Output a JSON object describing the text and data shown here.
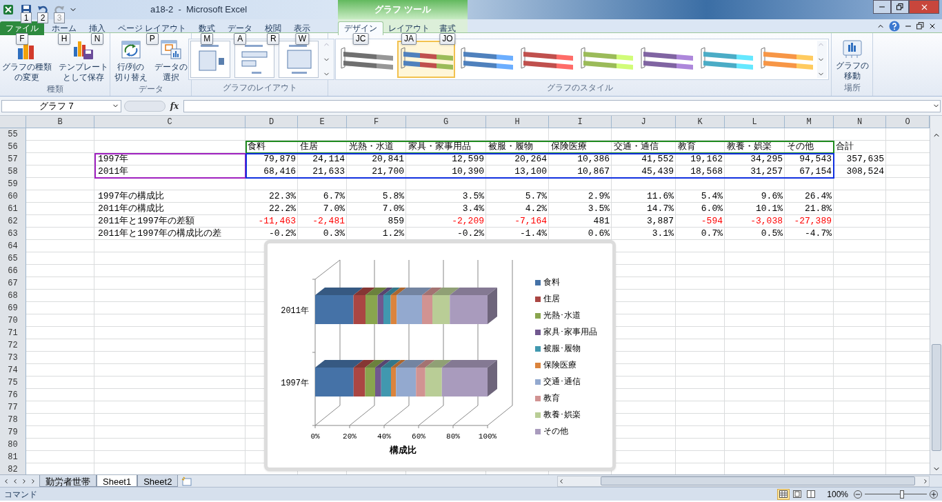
{
  "window": {
    "title": "a18-2  -  Microsoft Excel",
    "context_title": "グラフ ツール"
  },
  "quick_access": [
    {
      "keytip": "1",
      "disabled": false
    },
    {
      "keytip": "2",
      "disabled": false
    },
    {
      "keytip": "3",
      "disabled": true
    }
  ],
  "tabs": [
    {
      "label": "ファイル",
      "keytip": "F",
      "selected": false,
      "kind": "file"
    },
    {
      "label": "ホーム",
      "keytip": "H",
      "selected": false,
      "kind": "normal"
    },
    {
      "label": "挿入",
      "keytip": "N",
      "selected": false,
      "kind": "normal"
    },
    {
      "label": "ページ レイアウト",
      "keytip": "P",
      "selected": false,
      "kind": "normal"
    },
    {
      "label": "数式",
      "keytip": "M",
      "selected": false,
      "kind": "normal"
    },
    {
      "label": "データ",
      "keytip": "A",
      "selected": false,
      "kind": "normal"
    },
    {
      "label": "校閲",
      "keytip": "R",
      "selected": false,
      "kind": "normal"
    },
    {
      "label": "表示",
      "keytip": "W",
      "selected": false,
      "kind": "normal"
    },
    {
      "label": "デザイン",
      "keytip": "JC",
      "selected": true,
      "kind": "context"
    },
    {
      "label": "レイアウト",
      "keytip": "JA",
      "selected": false,
      "kind": "context"
    },
    {
      "label": "書式",
      "keytip": "JO",
      "selected": false,
      "kind": "context"
    }
  ],
  "ribbon": {
    "groups": [
      {
        "label": "種類",
        "kind": "buttons",
        "buttons": [
          {
            "lines": [
              "グラフの種類",
              "の変更"
            ]
          },
          {
            "lines": [
              "テンプレート",
              "として保存"
            ]
          }
        ]
      },
      {
        "label": "データ",
        "kind": "buttons",
        "buttons": [
          {
            "lines": [
              "行/列の",
              "切り替え"
            ]
          },
          {
            "lines": [
              "データの",
              "選択"
            ]
          }
        ]
      },
      {
        "label": "グラフのレイアウト",
        "kind": "layouts",
        "items": [
          {
            "selected": false
          },
          {
            "selected": false
          },
          {
            "selected": false
          }
        ]
      },
      {
        "label": "グラフのスタイル",
        "kind": "styles",
        "items": [
          {
            "kind": "mono",
            "color": "#707070",
            "selected": false
          },
          {
            "kind": "multi",
            "color": "#4f81bd",
            "selected": true
          },
          {
            "kind": "mono",
            "color": "#4f81bd",
            "selected": false
          },
          {
            "kind": "mono",
            "color": "#c0504d",
            "selected": false
          },
          {
            "kind": "mono",
            "color": "#9bbb59",
            "selected": false
          },
          {
            "kind": "mono",
            "color": "#8064a2",
            "selected": false
          },
          {
            "kind": "mono",
            "color": "#4bacc6",
            "selected": false
          },
          {
            "kind": "mono",
            "color": "#f79646",
            "selected": false
          }
        ]
      },
      {
        "label": "場所",
        "kind": "buttons",
        "buttons": [
          {
            "lines": [
              "グラフの",
              "移動"
            ]
          }
        ]
      }
    ]
  },
  "formula_bar": {
    "name_box": "グラフ 7",
    "function_label": "fx"
  },
  "grid": {
    "columns": [
      "B",
      "C",
      "D",
      "E",
      "F",
      "G",
      "H",
      "I",
      "J",
      "K",
      "L",
      "M",
      "N",
      "O"
    ],
    "rows": [
      {
        "number": "55",
        "kind": "values"
      },
      {
        "number": "56",
        "kind": "header",
        "cells": [
          {
            "text": "食料"
          },
          {
            "text": "住居"
          },
          {
            "text": "光熱・水道"
          },
          {
            "text": "家具・家事用品"
          },
          {
            "text": "被服・履物"
          },
          {
            "text": "保険医療"
          },
          {
            "text": "交通・通信"
          },
          {
            "text": "教育"
          },
          {
            "text": "教養・娯楽"
          },
          {
            "text": "その他"
          },
          {
            "text": "合計"
          }
        ]
      },
      {
        "number": "57",
        "kind": "values",
        "label": "1997年",
        "cells": [
          {
            "text": "79,879"
          },
          {
            "text": "24,114"
          },
          {
            "text": "20,841"
          },
          {
            "text": "12,599"
          },
          {
            "text": "20,264"
          },
          {
            "text": "10,386"
          },
          {
            "text": "41,552"
          },
          {
            "text": "19,162"
          },
          {
            "text": "34,295"
          },
          {
            "text": "94,543"
          },
          {
            "text": "357,635"
          }
        ]
      },
      {
        "number": "58",
        "kind": "values",
        "label": "2011年",
        "cells": [
          {
            "text": "68,416"
          },
          {
            "text": "21,633"
          },
          {
            "text": "21,700"
          },
          {
            "text": "10,390"
          },
          {
            "text": "13,100"
          },
          {
            "text": "10,867"
          },
          {
            "text": "45,439"
          },
          {
            "text": "18,568"
          },
          {
            "text": "31,257"
          },
          {
            "text": "67,154"
          },
          {
            "text": "308,524"
          }
        ]
      },
      {
        "number": "59",
        "kind": "values"
      },
      {
        "number": "60",
        "kind": "values",
        "label": "1997年の構成比",
        "cells": [
          {
            "text": "22.3%"
          },
          {
            "text": "6.7%"
          },
          {
            "text": "5.8%"
          },
          {
            "text": "3.5%"
          },
          {
            "text": "5.7%"
          },
          {
            "text": "2.9%"
          },
          {
            "text": "11.6%"
          },
          {
            "text": "5.4%"
          },
          {
            "text": "9.6%"
          },
          {
            "text": "26.4%"
          }
        ]
      },
      {
        "number": "61",
        "kind": "values",
        "label": "2011年の構成比",
        "cells": [
          {
            "text": "22.2%"
          },
          {
            "text": "7.0%"
          },
          {
            "text": "7.0%"
          },
          {
            "text": "3.4%"
          },
          {
            "text": "4.2%"
          },
          {
            "text": "3.5%"
          },
          {
            "text": "14.7%"
          },
          {
            "text": "6.0%"
          },
          {
            "text": "10.1%"
          },
          {
            "text": "21.8%"
          }
        ]
      },
      {
        "number": "62",
        "kind": "values",
        "label": "2011年と1997年の差額",
        "cells": [
          {
            "text": "-11,463",
            "red": true
          },
          {
            "text": "-2,481",
            "red": true
          },
          {
            "text": "859",
            "red": false
          },
          {
            "text": "-2,209",
            "red": true
          },
          {
            "text": "-7,164",
            "red": true
          },
          {
            "text": "481",
            "red": false
          },
          {
            "text": "3,887",
            "red": false
          },
          {
            "text": "-594",
            "red": true
          },
          {
            "text": "-3,038",
            "red": true
          },
          {
            "text": "-27,389",
            "red": true
          }
        ]
      },
      {
        "number": "63",
        "kind": "values",
        "label": "2011年と1997年の構成比の差",
        "cells": [
          {
            "text": "-0.2%"
          },
          {
            "text": "0.3%"
          },
          {
            "text": "1.2%"
          },
          {
            "text": "-0.2%"
          },
          {
            "text": "-1.4%"
          },
          {
            "text": "0.6%"
          },
          {
            "text": "3.1%"
          },
          {
            "text": "0.7%"
          },
          {
            "text": "0.5%"
          },
          {
            "text": "-4.7%"
          }
        ]
      },
      {
        "number": "64"
      },
      {
        "number": "65"
      },
      {
        "number": "66"
      },
      {
        "number": "67"
      },
      {
        "number": "68"
      },
      {
        "number": "69"
      },
      {
        "number": "70"
      },
      {
        "number": "71"
      },
      {
        "number": "72"
      },
      {
        "number": "73"
      },
      {
        "number": "74"
      },
      {
        "number": "75"
      },
      {
        "number": "76"
      },
      {
        "number": "77"
      },
      {
        "number": "78"
      },
      {
        "number": "79"
      },
      {
        "number": "80"
      },
      {
        "number": "81"
      },
      {
        "number": "82"
      }
    ]
  },
  "chart": {
    "chart_data": {
      "type": "bar",
      "orientation": "horizontal",
      "stacked": true,
      "xlabel": "構成比",
      "categories": [
        "2011年",
        "1997年"
      ],
      "series": [
        {
          "name": "食料",
          "color": "#4572a7",
          "values": [
            0.222,
            0.223
          ]
        },
        {
          "name": "住居",
          "color": "#aa4643",
          "values": [
            0.07,
            0.067
          ]
        },
        {
          "name": "光熱･水道",
          "color": "#89a54e",
          "values": [
            0.07,
            0.058
          ]
        },
        {
          "name": "家具･家事用品",
          "color": "#71588f",
          "values": [
            0.034,
            0.035
          ]
        },
        {
          "name": "被服･履物",
          "color": "#4198af",
          "values": [
            0.042,
            0.057
          ]
        },
        {
          "name": "保険医療",
          "color": "#db843d",
          "values": [
            0.035,
            0.029
          ]
        },
        {
          "name": "交通･通信",
          "color": "#93a9cf",
          "values": [
            0.147,
            0.116
          ]
        },
        {
          "name": "教育",
          "color": "#d19392",
          "values": [
            0.06,
            0.054
          ]
        },
        {
          "name": "教養･娯楽",
          "color": "#b9cd96",
          "values": [
            0.101,
            0.096
          ]
        },
        {
          "name": "その他",
          "color": "#a99bbd",
          "values": [
            0.219,
            0.265
          ]
        }
      ],
      "legend": "right",
      "xlim": [
        0,
        1
      ],
      "xticks": [
        {
          "value": 0,
          "label": "0%"
        },
        {
          "value": 0.2,
          "label": "20%"
        },
        {
          "value": 0.4,
          "label": "40%"
        },
        {
          "value": 0.6,
          "label": "60%"
        },
        {
          "value": 0.8,
          "label": "80%"
        },
        {
          "value": 1,
          "label": "100%"
        }
      ]
    }
  },
  "sheet_tabs": [
    {
      "label": "勤労者世帯",
      "selected": false
    },
    {
      "label": "Sheet1",
      "selected": true
    },
    {
      "label": "Sheet2",
      "selected": false
    }
  ],
  "status_bar": {
    "mode": "コマンド",
    "views": [
      {
        "selected": true
      },
      {
        "selected": false
      },
      {
        "selected": false
      }
    ],
    "zoom": "100%",
    "zoom_slider": {
      "level": 0.6
    }
  }
}
